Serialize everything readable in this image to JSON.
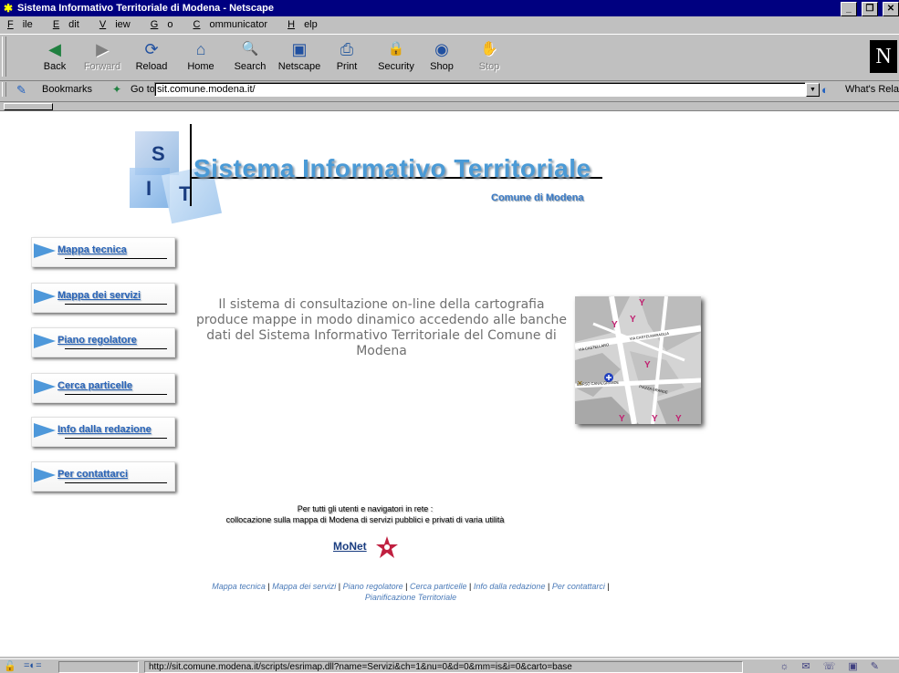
{
  "window": {
    "title": "Sistema Informativo Territoriale di Modena - Netscape",
    "controls": [
      "_",
      "❐",
      "✕"
    ]
  },
  "menu": {
    "items": [
      {
        "label": "File",
        "u": "F",
        "rest": "ile"
      },
      {
        "label": "Edit",
        "u": "E",
        "rest": "dit"
      },
      {
        "label": "View",
        "u": "V",
        "rest": "iew"
      },
      {
        "label": "Go",
        "u": "G",
        "rest": "o"
      },
      {
        "label": "Communicator",
        "u": "C",
        "rest": "ommunicator"
      },
      {
        "label": "Help",
        "u": "H",
        "rest": "elp"
      }
    ]
  },
  "toolbar": {
    "buttons": [
      {
        "label": "Back",
        "icon": "back-arrow-icon",
        "glyph": "◀"
      },
      {
        "label": "Forward",
        "icon": "forward-arrow-icon",
        "glyph": "▶"
      },
      {
        "label": "Reload",
        "icon": "reload-icon",
        "glyph": "⟳"
      },
      {
        "label": "Home",
        "icon": "home-icon",
        "glyph": "⌂"
      },
      {
        "label": "Search",
        "icon": "search-icon",
        "glyph": "🔍"
      },
      {
        "label": "Netscape",
        "icon": "my-netscape-icon",
        "glyph": "▣"
      },
      {
        "label": "Print",
        "icon": "print-icon",
        "glyph": "⎙"
      },
      {
        "label": "Security",
        "icon": "security-lock-icon",
        "glyph": "🔒"
      },
      {
        "label": "Shop",
        "icon": "shop-icon",
        "glyph": "◉"
      },
      {
        "label": "Stop",
        "icon": "stop-icon",
        "glyph": "✋"
      }
    ],
    "logo": "N"
  },
  "location": {
    "bookmarks_label": "Bookmarks",
    "goto_label": "Go to:",
    "url": "sit.comune.modena.it/",
    "whats_related": "What's Related"
  },
  "page": {
    "logo_letters": [
      "S",
      "I",
      "T"
    ],
    "title": "Sistema Informativo Territoriale",
    "subtitle": "Comune di Modena",
    "nav": [
      "Mappa tecnica",
      "Mappa dei servizi",
      "Piano regolatore",
      "Cerca particelle",
      "Info dalla redazione",
      "Per contattarci"
    ],
    "description": "Il sistema di consultazione on-line della cartografia produce mappe in modo dinamico accedendo alle banche dati del Sistema Informativo Territoriale del Comune di Modena",
    "tagline_1": "Per tutti gli utenti e navigatori in rete :",
    "tagline_2": "collocazione sulla mappa di Modena di servizi pubblici e privati di varia utilità",
    "monet": "MoNet",
    "footer_links": [
      "Mappa tecnica",
      "Mappa dei servizi",
      "Piano regolatore",
      "Cerca particelle",
      "Info dalla redazione",
      "Per contattarci"
    ],
    "footer_extra": "Pianificazione Territoriale"
  },
  "status": {
    "url": "http://sit.comune.modena.it/scripts/esrimap.dll?name=Servizi&ch=1&nu=0&d=0&mm=is&i=0&carto=base"
  },
  "colors": {
    "title_blue": "#4a9ad6",
    "dark_blue": "#1a3d80",
    "link_blue": "#2a64b8",
    "titlebar": "#000080"
  }
}
